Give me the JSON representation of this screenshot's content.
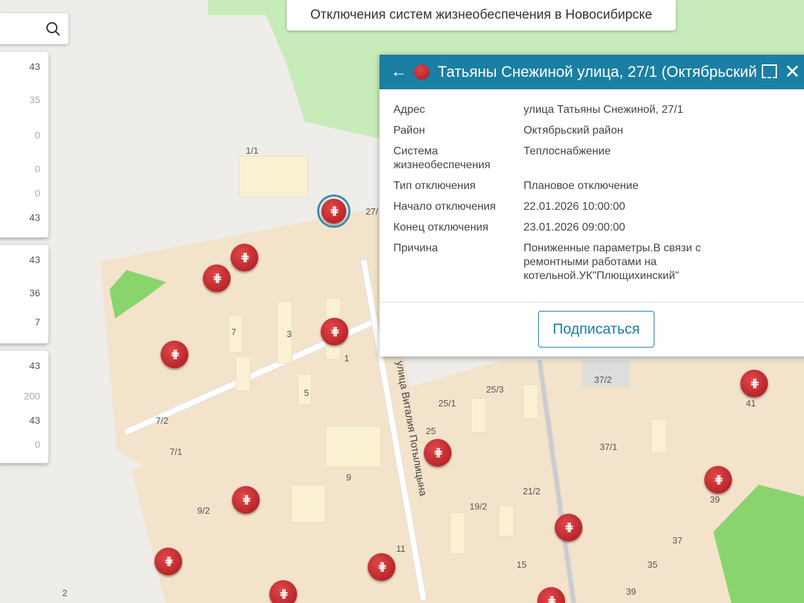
{
  "map_title": "Отключения систем жизнеобеспечения в Новосибирске",
  "search": {
    "icon": "search-icon"
  },
  "panels": [
    {
      "values": [
        "43",
        "35",
        "0",
        "0",
        "0",
        "43"
      ]
    },
    {
      "values": [
        "43",
        "36",
        "7"
      ]
    },
    {
      "values": [
        "43",
        "200",
        "43",
        "0"
      ]
    }
  ],
  "popup": {
    "title": "Татьяны Снежиной улица, 27/1 (Октябрьский...",
    "rows": [
      {
        "k": "Адрес",
        "v": "улица Татьяны Снежиной, 27/1"
      },
      {
        "k": "Район",
        "v": "Октябрьский район"
      },
      {
        "k": "Система жизнеобеспечения",
        "v": "Теплоснабжение"
      },
      {
        "k": "Тип отключения",
        "v": "Плановое отключение"
      },
      {
        "k": "Начало отключения",
        "v": "22.01.2026 10:00:00"
      },
      {
        "k": "Конец отключения",
        "v": "23.01.2026 09:00:00"
      },
      {
        "k": "Причина",
        "v": "Пониженные параметры.В связи с ремонтными работами на котельной.УК\"Плющихинский\""
      }
    ],
    "subscribe": "Подписаться"
  },
  "map_labels": {
    "street": "улица Виталия Потылицына",
    "houses": [
      "1/1",
      "27/",
      "7",
      "3",
      "1",
      "5",
      "7/2",
      "7/1",
      "9",
      "9/2",
      "11",
      "25",
      "25/1",
      "25/3",
      "19/2",
      "21/2",
      "15",
      "37/2",
      "37/1",
      "41",
      "39",
      "37",
      "35",
      "39",
      "2"
    ]
  }
}
